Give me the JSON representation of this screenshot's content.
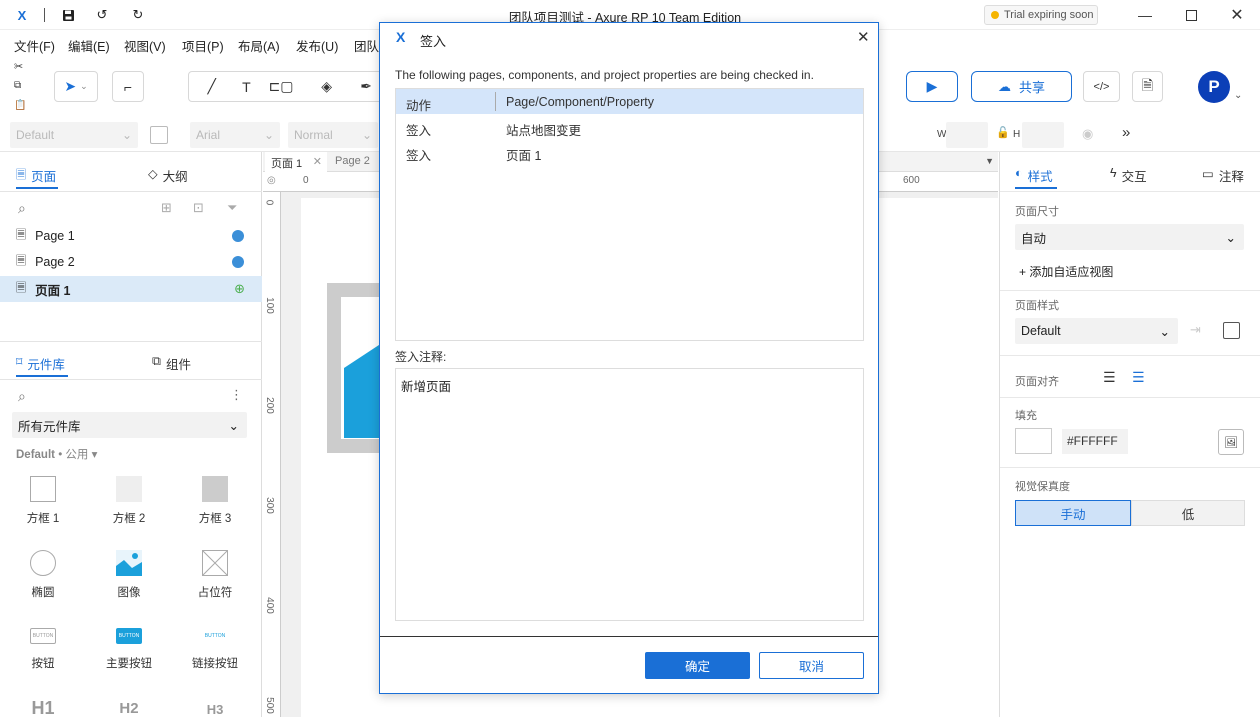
{
  "app": {
    "title": "团队项目测试 - Axure RP 10 Team Edition",
    "trial": "Trial expiring soon"
  },
  "menu": [
    "文件(F)",
    "编辑(E)",
    "视图(V)",
    "项目(P)",
    "布局(A)",
    "发布(U)",
    "团队"
  ],
  "toolbar": {
    "share_label": "共享",
    "avatar_letter": "P"
  },
  "propbar": {
    "style": "Default",
    "font": "Arial",
    "weight": "Normal",
    "w_label": "W",
    "h_label": "H"
  },
  "left": {
    "tabs": {
      "pages": "页面",
      "outline": "大纲"
    },
    "pages": [
      {
        "label": "Page 1"
      },
      {
        "label": "Page 2"
      },
      {
        "label": "页面 1"
      }
    ],
    "lib_tabs": {
      "library": "元件库",
      "components": "组件"
    },
    "lib_select": "所有元件库",
    "lib_group": "Default",
    "lib_group_suffix": "• 公用",
    "widgets": [
      "方框 1",
      "方框 2",
      "方框 3",
      "椭圆",
      "图像",
      "占位符",
      "按钮",
      "主要按钮",
      "链接按钮",
      "H1",
      "H2",
      "H3"
    ],
    "button_preview": "BUTTON"
  },
  "canvas": {
    "tabs": [
      "页面 1",
      "Page 2"
    ],
    "ruler_h": [
      "0",
      "600"
    ],
    "ruler_v": [
      "0",
      "100",
      "200",
      "300",
      "400",
      "500"
    ]
  },
  "right": {
    "tabs": {
      "style": "样式",
      "interact": "交互",
      "notes": "注释"
    },
    "page_size_label": "页面尺寸",
    "page_size": "自动",
    "add_view": "+ 添加自适应视图",
    "page_style_label": "页面样式",
    "page_style": "Default",
    "align_label": "页面对齐",
    "fill_label": "填充",
    "fill_value": "#FFFFFF",
    "fidelity_label": "视觉保真度",
    "fidelity_manual": "手动",
    "fidelity_low": "低"
  },
  "dialog": {
    "title": "签入",
    "message": "The following pages, components, and project properties are being checked in.",
    "columns": [
      "动作",
      "Page/Component/Property"
    ],
    "rows": [
      [
        "签入",
        "站点地图变更"
      ],
      [
        "签入",
        "页面 1"
      ]
    ],
    "note_label": "签入注释:",
    "note_value": "新增页面",
    "ok": "确定",
    "cancel": "取消"
  },
  "colors": {
    "accent": "#1a6fd6",
    "selection": "#dbeaf8",
    "status_dot": "#3b8fd8",
    "widget_blue": "#1ba0db"
  }
}
